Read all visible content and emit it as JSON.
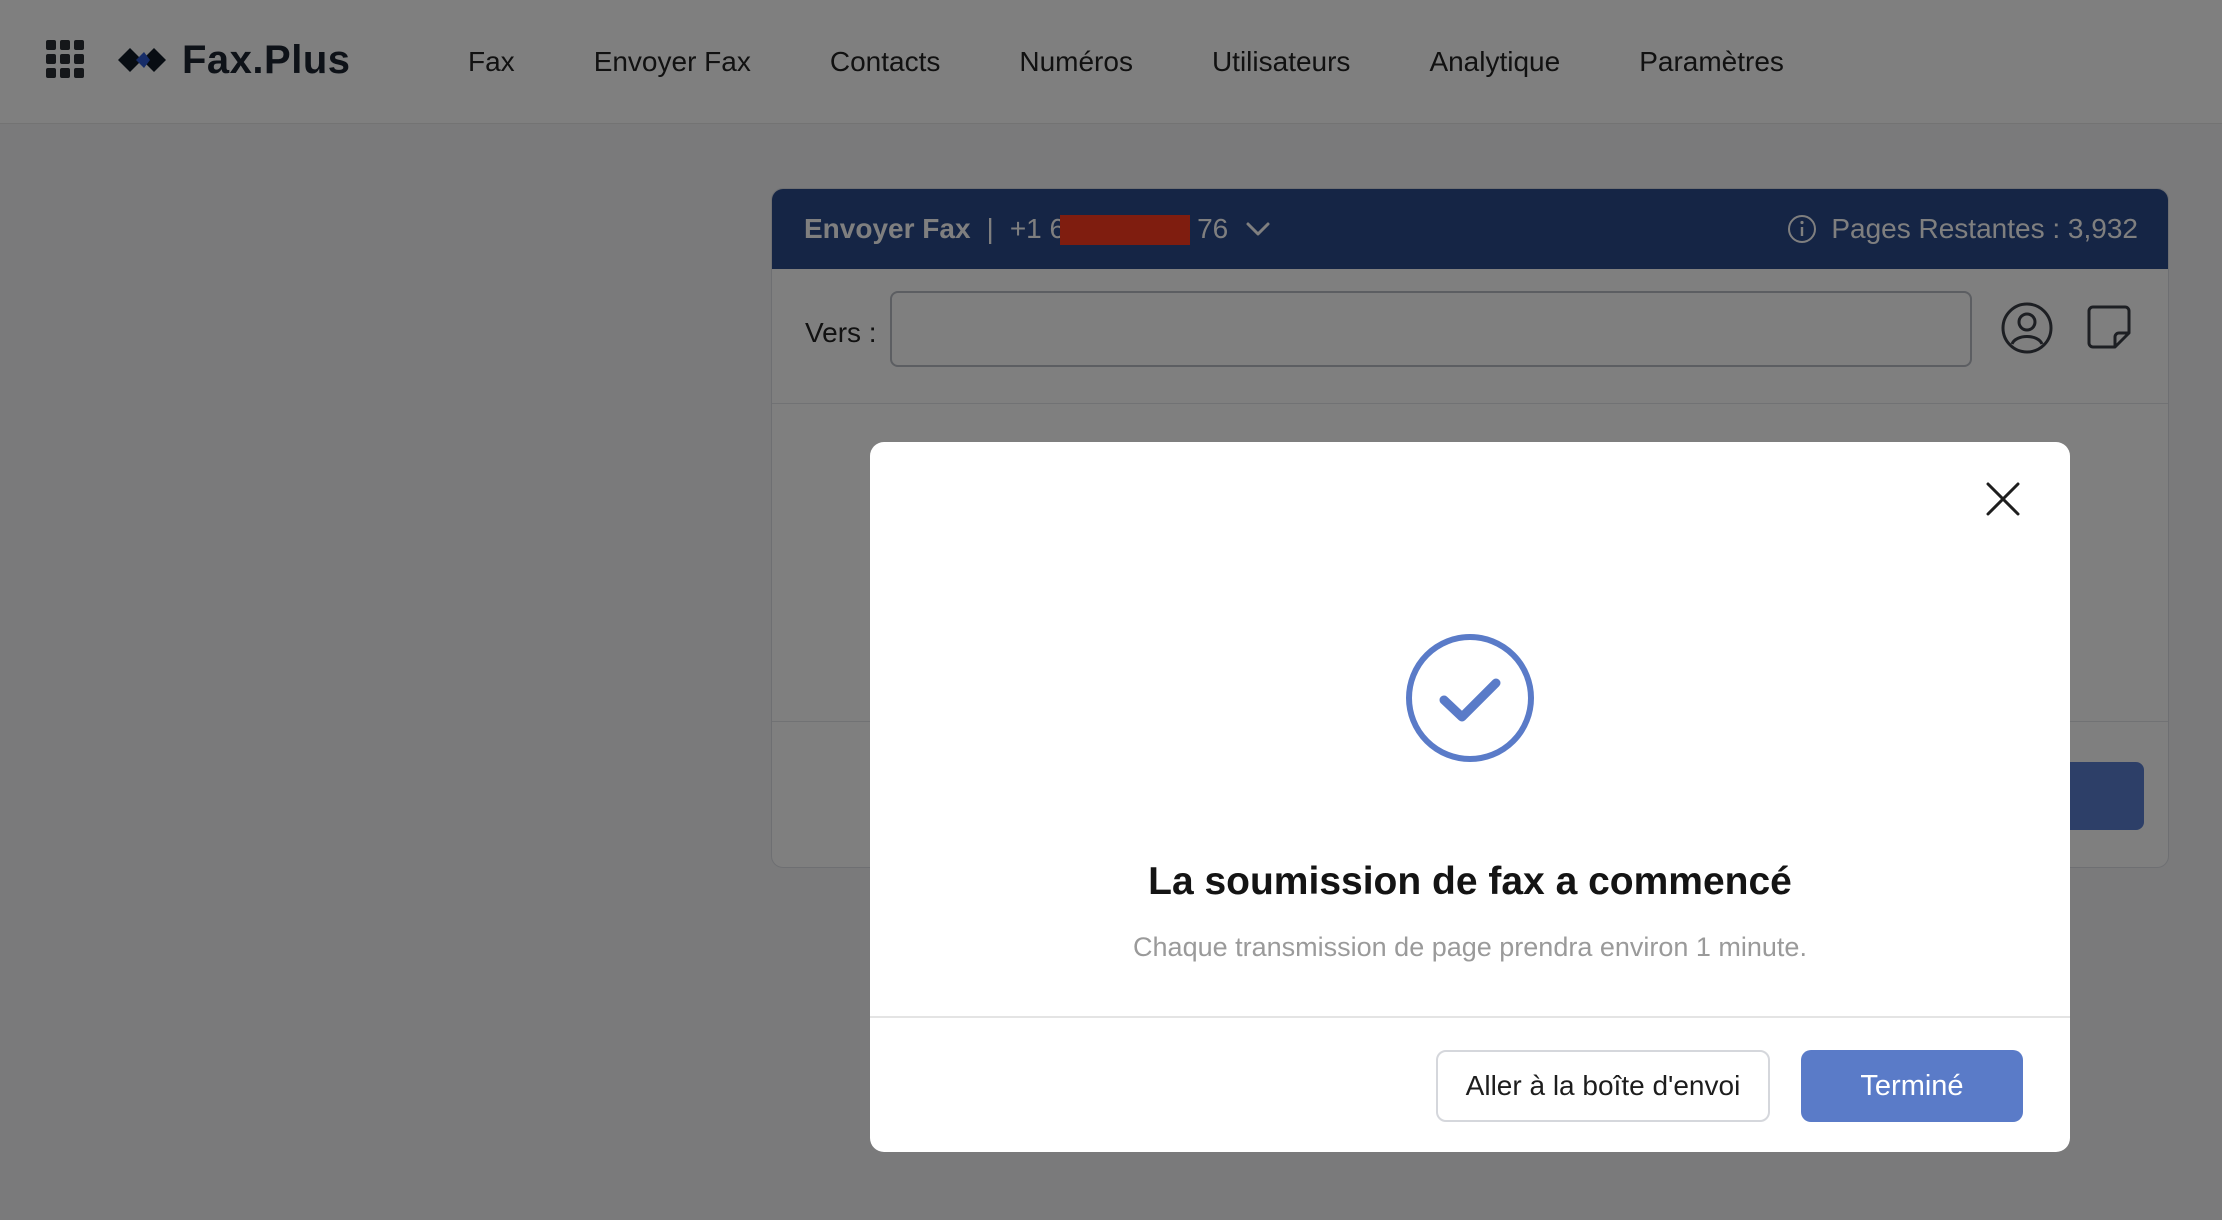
{
  "app": {
    "logo_text": "Fax.Plus",
    "icons": {
      "apps": "apps-grid-icon",
      "logo": "faxplus-logo-icon"
    }
  },
  "nav": {
    "items": [
      {
        "label": "Fax"
      },
      {
        "label": "Envoyer Fax"
      },
      {
        "label": "Contacts"
      },
      {
        "label": "Numéros"
      },
      {
        "label": "Utilisateurs"
      },
      {
        "label": "Analytique"
      },
      {
        "label": "Paramètres"
      }
    ]
  },
  "send_fax": {
    "title": "Envoyer Fax",
    "separator": "|",
    "sender_number_prefix": "+1 6",
    "sender_number_suffix": "76",
    "sender_number_redacted": true,
    "pages_remaining_label": "Pages Restantes : 3,932",
    "to_label": "Vers :",
    "to_value": "",
    "header_color": "#2b4a8a",
    "icons": {
      "dropdown": "chevron-down-icon",
      "info": "info-icon",
      "contacts": "contact-icon",
      "note": "note-icon"
    }
  },
  "modal": {
    "title": "La soumission de fax a commencé",
    "subtitle": "Chaque transmission de page prendra environ 1 minute.",
    "outbox_button": "Aller à la boîte d'envoi",
    "done_button": "Terminé",
    "accent_color": "#5a7bc8",
    "icons": {
      "close": "close-icon",
      "success": "check-circle-icon"
    }
  }
}
